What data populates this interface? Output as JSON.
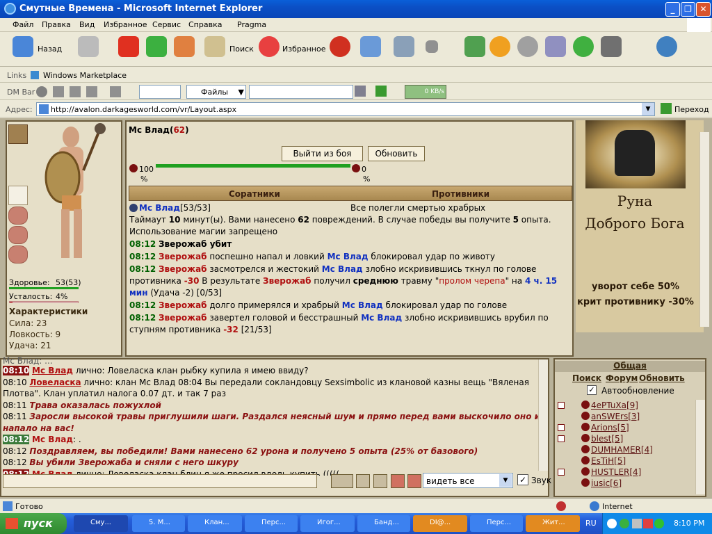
{
  "window": {
    "title": "Смутные Времена - Microsoft Internet Explorer"
  },
  "menu": [
    "Файл",
    "Правка",
    "Вид",
    "Избранное",
    "Сервис",
    "Справка",
    "Pragma"
  ],
  "toolbar": {
    "back": "Назад",
    "search": "Поиск",
    "favorites": "Избранное"
  },
  "links": {
    "label": "Links",
    "item": "Windows Marketplace"
  },
  "dmbar": {
    "label": "DM Bar",
    "files": "Файлы",
    "speed": "0 KB/s"
  },
  "address": {
    "label": "Адрес:",
    "url": "http://avalon.darkagesworld.com/vr/Layout.aspx",
    "go": "Переход"
  },
  "character": {
    "health_label": "Здоровье:",
    "health_value": "53(53)",
    "fatigue_label": "Усталость:",
    "fatigue_value": "4%",
    "stats_title": "Характеристики",
    "stats": [
      "Сила: 23",
      "Ловкость: 9",
      "Удача: 21"
    ],
    "health_fraction": 1.0,
    "fatigue_fraction": 0.04
  },
  "battle": {
    "name": "Мс Влад",
    "level": "62",
    "exit_button": "Выйти из боя",
    "refresh_button": "Обновить",
    "our_pct": "100",
    "our_pct_sym": "%",
    "their_pct": "0",
    "their_pct_sym": "%",
    "our_fraction": 1.0,
    "allies_header": "Соратники",
    "enemies_header": "Противники",
    "ally": "Мс Влад",
    "ally_hp": "[53/53]",
    "enemies_text": "Все полегли смертью храбрых",
    "timeout_1": "Таймаут ",
    "timeout_2": "10",
    "timeout_3": " минут(ы). Вами нанесено ",
    "timeout_4": "62",
    "timeout_5": " повреждений. В случае победы вы получите ",
    "timeout_6": "5",
    "timeout_7": " опыта.",
    "magic": "Использование магии запрещено",
    "log": [
      {
        "time": "08:12",
        "text": "Зверожаб убит"
      },
      {
        "time": "08:12",
        "a": "Зверожаб",
        "t1": " поспешно напал и ловкий ",
        "b": "Мс Влад",
        "t2": " блокировал удар по животу"
      },
      {
        "time": "08:12",
        "a": "Зверожаб",
        "t1": " засмотрелся и жестокий ",
        "b": "Мс Влад",
        "t2": " злобно искривившись ткнул по голове противника ",
        "dmg": "-30",
        "t3": " В результате ",
        "c": "Зверожаб",
        "t4": " получил ",
        "sev": "среднюю",
        "t5": " травму \"",
        "trauma": "пролом черепа",
        "t6": "\" на ",
        "dur": "4 ч. 15 мин",
        "t7": " (Удача -2) [0/53]"
      },
      {
        "time": "08:12",
        "a": "Зверожаб",
        "t1": " долго примерялся и храбрый ",
        "b": "Мс Влад",
        "t2": " блокировал удар по голове"
      },
      {
        "time": "08:12",
        "a": "Зверожаб",
        "t1": " завертел головой и бесстрашный ",
        "b": "Мс Влад",
        "t2": " злобно искривившись врубил по ступням противника ",
        "dmg": "-32",
        "t3": " [21/53]"
      }
    ]
  },
  "rune": {
    "title1": "Руна",
    "title2": "Доброго Бога",
    "desc1": "уворот себе 50%",
    "desc2": "крит противнику -30%"
  },
  "chat": {
    "lines": [
      {
        "time": "08:10",
        "who": "Мс Влад",
        "rest": " лично: Ловеласка клан рыбку купила я имею ввиду?"
      },
      {
        "time": "08:10",
        "who": "Ловеласка",
        "rest": " лично: клан Мс Влад 08:04 Вы передали сокландовцу Sexsimbolic из клановой казны вещь \"Вяленая"
      },
      {
        "text": "Плотва\". Клан уплатил налога 0.07 дт. и так 7 раз"
      },
      {
        "time": "08:11",
        "msg": "Трава оказалась пожухлой"
      },
      {
        "time": "08:11",
        "msg": "Заросли высокой травы приглушили шаги. Раздался неясный шум и прямо перед вами выскочило оно и"
      },
      {
        "msg": "напало на вас!"
      },
      {
        "time": "08:12",
        "who": "Мс Влад",
        "rest": ": ."
      },
      {
        "time": "08:12",
        "msg": "Поздравляем, вы победили! Вами нанесено 62 урона и получено 5 опыта (25% от базового)"
      },
      {
        "time": "08:12",
        "msg": "Вы убили Зверожаба и сняли с него шкуру"
      },
      {
        "time": "08:12",
        "who": "Мс Влад",
        "rest": " лично: Ловеласка клан блин я же просил вдоль купить ((((("
      }
    ],
    "top_partial": "Мс Влад: ... ",
    "see_all": "видеть все",
    "sound": "Звук"
  },
  "online": {
    "tab": "Общая",
    "search": "Поиск",
    "forum": "Форум",
    "refresh": "Обновить",
    "auto": "Автообновление",
    "users": [
      {
        "name": "4ePTuXa",
        "lvl": "[9]"
      },
      {
        "name": "anSWErs",
        "lvl": "[3]"
      },
      {
        "name": "Arions",
        "lvl": "[5]"
      },
      {
        "name": "blest",
        "lvl": "[5]"
      },
      {
        "name": "DUMHAMER",
        "lvl": "[4]"
      },
      {
        "name": "EsTiH",
        "lvl": "[5]"
      },
      {
        "name": "HUSTLER",
        "lvl": "[4]"
      },
      {
        "name": "iusic",
        "lvl": "[6]"
      }
    ]
  },
  "status": {
    "ready": "Готово",
    "zone": "Internet"
  },
  "taskbar": {
    "start": "пуск",
    "items": [
      "Сму...",
      "5. M...",
      "Клан...",
      "Перс...",
      "Игог...",
      "Банд...",
      "DI@...",
      "Перс...",
      "Жит..."
    ],
    "lang": "RU",
    "clock": "8:10 PM"
  }
}
